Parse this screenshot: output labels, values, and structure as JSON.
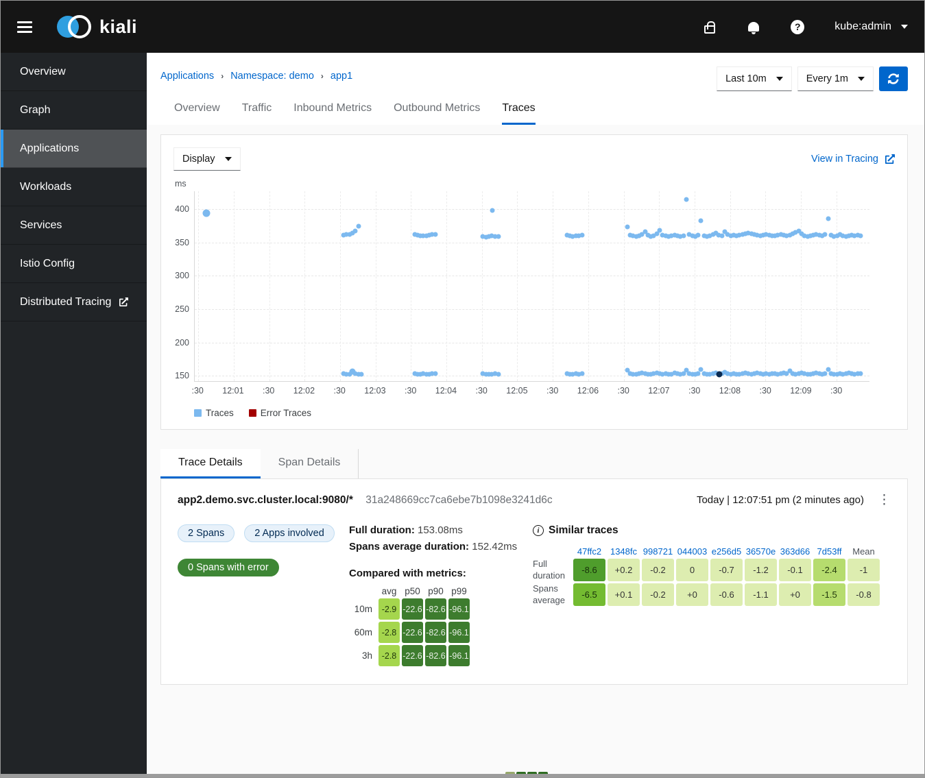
{
  "masthead": {
    "brand": "kiali",
    "user": "kube:admin"
  },
  "sidebar": {
    "active_index": 2,
    "items": [
      {
        "label": "Overview"
      },
      {
        "label": "Graph"
      },
      {
        "label": "Applications"
      },
      {
        "label": "Workloads"
      },
      {
        "label": "Services"
      },
      {
        "label": "Istio Config"
      },
      {
        "label": "Distributed Tracing",
        "external": true
      }
    ]
  },
  "breadcrumb": [
    "Applications",
    "Namespace: demo",
    "app1"
  ],
  "toolbar": {
    "duration": "Last 10m",
    "refresh_interval": "Every 1m"
  },
  "tabs": {
    "active_index": 4,
    "items": [
      "Overview",
      "Traffic",
      "Inbound Metrics",
      "Outbound Metrics",
      "Traces"
    ]
  },
  "chart_card": {
    "display_label": "Display",
    "view_link": "View in Tracing",
    "unit": "ms"
  },
  "chart_data": {
    "type": "scatter",
    "title": "",
    "xlabel": "",
    "ylabel": "ms",
    "grid": true,
    "legend_position": "bottom",
    "x_range": [
      27,
      598
    ],
    "y_range": [
      142,
      427
    ],
    "y_ticks": [
      150,
      200,
      250,
      300,
      350,
      400
    ],
    "x_ticks": [
      {
        "t": 30,
        "label": ":30"
      },
      {
        "t": 60,
        "label": "12:01"
      },
      {
        "t": 90,
        "label": ":30"
      },
      {
        "t": 120,
        "label": "12:02"
      },
      {
        "t": 150,
        "label": ":30"
      },
      {
        "t": 180,
        "label": "12:03"
      },
      {
        "t": 210,
        "label": ":30"
      },
      {
        "t": 240,
        "label": "12:04"
      },
      {
        "t": 270,
        "label": ":30"
      },
      {
        "t": 300,
        "label": "12:05"
      },
      {
        "t": 330,
        "label": ":30"
      },
      {
        "t": 360,
        "label": "12:06"
      },
      {
        "t": 390,
        "label": ":30"
      },
      {
        "t": 420,
        "label": "12:07"
      },
      {
        "t": 450,
        "label": ":30"
      },
      {
        "t": 480,
        "label": "12:08"
      },
      {
        "t": 510,
        "label": ":30"
      },
      {
        "t": 540,
        "label": "12:09"
      },
      {
        "t": 570,
        "label": ":30"
      }
    ],
    "series": [
      {
        "name": "Traces",
        "color": "#7cb9ef",
        "points": [
          [
            37,
            394,
            11
          ],
          [
            153,
            361
          ],
          [
            155.5,
            362
          ],
          [
            158,
            362
          ],
          [
            160.5,
            364
          ],
          [
            163,
            367
          ],
          [
            165.5,
            375
          ],
          [
            153,
            153
          ],
          [
            155.5,
            152
          ],
          [
            158,
            152
          ],
          [
            160.5,
            156,
            9
          ],
          [
            163,
            153
          ],
          [
            165.5,
            152
          ],
          [
            168,
            152
          ],
          [
            213,
            362
          ],
          [
            215.5,
            361
          ],
          [
            218,
            360
          ],
          [
            220.5,
            360
          ],
          [
            223,
            360
          ],
          [
            225.5,
            361
          ],
          [
            228,
            362
          ],
          [
            230.5,
            362
          ],
          [
            213,
            153
          ],
          [
            215.5,
            152
          ],
          [
            218,
            152
          ],
          [
            220.5,
            153
          ],
          [
            223,
            152
          ],
          [
            225.5,
            152
          ],
          [
            228,
            153
          ],
          [
            230.5,
            153
          ],
          [
            271,
            359
          ],
          [
            273.5,
            358
          ],
          [
            276,
            359
          ],
          [
            278.5,
            360
          ],
          [
            281,
            359
          ],
          [
            284,
            359
          ],
          [
            279,
            398
          ],
          [
            271,
            153
          ],
          [
            273.5,
            152
          ],
          [
            276,
            152
          ],
          [
            278.5,
            152
          ],
          [
            281,
            153
          ],
          [
            284,
            152
          ],
          [
            342,
            361
          ],
          [
            344.5,
            360
          ],
          [
            347,
            359
          ],
          [
            349.5,
            360
          ],
          [
            352,
            360
          ],
          [
            355,
            361
          ],
          [
            342,
            153
          ],
          [
            344.5,
            152
          ],
          [
            347,
            152
          ],
          [
            349.5,
            153
          ],
          [
            352,
            152
          ],
          [
            355,
            153
          ],
          [
            393,
            374
          ],
          [
            395.5,
            361
          ],
          [
            398,
            360
          ],
          [
            400.5,
            359
          ],
          [
            403,
            360
          ],
          [
            405.5,
            362
          ],
          [
            408,
            366
          ],
          [
            410.5,
            361
          ],
          [
            413,
            359
          ],
          [
            415.5,
            360
          ],
          [
            418,
            363
          ],
          [
            420.5,
            368
          ],
          [
            423,
            361
          ],
          [
            425.5,
            360
          ],
          [
            428,
            359
          ],
          [
            430.5,
            360
          ],
          [
            433,
            361
          ],
          [
            435.5,
            360
          ],
          [
            438,
            359
          ],
          [
            440.5,
            360
          ],
          [
            443,
            415
          ],
          [
            445.5,
            362
          ],
          [
            448,
            360
          ],
          [
            450.5,
            359
          ],
          [
            453,
            361
          ],
          [
            455.5,
            383
          ],
          [
            458,
            360
          ],
          [
            460.5,
            359
          ],
          [
            463,
            360
          ],
          [
            465.5,
            362
          ],
          [
            468,
            364
          ],
          [
            470.5,
            361
          ],
          [
            473,
            360
          ],
          [
            475.5,
            366
          ],
          [
            478,
            362
          ],
          [
            480.5,
            360
          ],
          [
            483,
            361
          ],
          [
            485.5,
            360
          ],
          [
            488,
            361
          ],
          [
            490.5,
            362
          ],
          [
            493,
            363
          ],
          [
            495.5,
            364
          ],
          [
            498,
            363
          ],
          [
            500.5,
            362
          ],
          [
            503,
            361
          ],
          [
            505.5,
            360
          ],
          [
            508,
            361
          ],
          [
            510.5,
            362
          ],
          [
            513,
            361
          ],
          [
            515.5,
            360
          ],
          [
            518,
            360
          ],
          [
            520.5,
            361
          ],
          [
            523,
            362
          ],
          [
            525.5,
            361
          ],
          [
            528,
            360
          ],
          [
            530.5,
            361
          ],
          [
            533,
            363
          ],
          [
            535.5,
            365
          ],
          [
            538,
            367
          ],
          [
            540.5,
            363
          ],
          [
            543,
            360
          ],
          [
            545.5,
            359
          ],
          [
            548,
            360
          ],
          [
            550.5,
            361
          ],
          [
            553,
            362
          ],
          [
            555.5,
            361
          ],
          [
            558,
            360
          ],
          [
            560.5,
            362
          ],
          [
            563,
            386
          ],
          [
            565.5,
            361
          ],
          [
            568,
            359
          ],
          [
            570.5,
            360
          ],
          [
            573,
            362
          ],
          [
            575.5,
            360
          ],
          [
            578,
            359
          ],
          [
            580.5,
            360
          ],
          [
            583,
            361
          ],
          [
            585.5,
            360
          ],
          [
            588,
            361
          ],
          [
            590.5,
            360
          ],
          [
            393,
            158
          ],
          [
            395.5,
            153
          ],
          [
            398,
            152
          ],
          [
            400.5,
            152
          ],
          [
            403,
            153
          ],
          [
            405.5,
            154
          ],
          [
            408,
            153
          ],
          [
            410.5,
            152
          ],
          [
            413,
            152
          ],
          [
            415.5,
            153
          ],
          [
            418,
            154
          ],
          [
            420.5,
            153
          ],
          [
            423,
            152
          ],
          [
            425.5,
            153
          ],
          [
            428,
            152
          ],
          [
            430.5,
            152
          ],
          [
            433,
            154
          ],
          [
            435.5,
            153
          ],
          [
            438,
            152
          ],
          [
            440.5,
            153
          ],
          [
            443,
            158
          ],
          [
            445.5,
            153
          ],
          [
            448,
            152
          ],
          [
            450.5,
            152
          ],
          [
            453,
            153
          ],
          [
            455.5,
            160
          ],
          [
            458,
            153
          ],
          [
            460.5,
            152
          ],
          [
            463,
            152
          ],
          [
            465.5,
            153
          ],
          [
            468,
            154
          ],
          [
            473,
            153
          ],
          [
            475.5,
            155
          ],
          [
            478,
            153
          ],
          [
            480.5,
            152
          ],
          [
            483,
            153
          ],
          [
            485.5,
            152
          ],
          [
            488,
            152
          ],
          [
            490.5,
            153
          ],
          [
            493,
            154
          ],
          [
            495.5,
            153
          ],
          [
            498,
            152
          ],
          [
            500.5,
            153
          ],
          [
            503,
            154
          ],
          [
            505.5,
            153
          ],
          [
            508,
            152
          ],
          [
            510.5,
            153
          ],
          [
            513,
            152
          ],
          [
            515.5,
            153
          ],
          [
            518,
            153
          ],
          [
            520.5,
            152
          ],
          [
            523,
            153
          ],
          [
            525.5,
            154
          ],
          [
            528,
            153
          ],
          [
            530.5,
            157
          ],
          [
            533,
            153
          ],
          [
            535.5,
            152
          ],
          [
            538,
            153
          ],
          [
            540.5,
            154
          ],
          [
            543,
            153
          ],
          [
            545.5,
            152
          ],
          [
            548,
            152
          ],
          [
            550.5,
            153
          ],
          [
            553,
            154
          ],
          [
            555.5,
            153
          ],
          [
            558,
            152
          ],
          [
            560.5,
            153
          ],
          [
            563,
            160
          ],
          [
            565.5,
            153
          ],
          [
            568,
            152
          ],
          [
            570.5,
            152
          ],
          [
            573,
            153
          ],
          [
            575.5,
            152
          ],
          [
            578,
            153
          ],
          [
            580.5,
            154
          ],
          [
            583,
            153
          ],
          [
            585.5,
            152
          ],
          [
            588,
            153
          ],
          [
            590.5,
            153
          ]
        ]
      },
      {
        "name": "Error Traces",
        "color": "#a30000",
        "points": []
      }
    ],
    "selected_point": {
      "t": 471,
      "v": 152,
      "d": 9,
      "color": "#0a2b52"
    }
  },
  "details": {
    "tabs": {
      "active_index": 0,
      "items": [
        "Trace Details",
        "Span Details"
      ]
    },
    "service": "app2.demo.svc.cluster.local:9080/*",
    "trace_id": "31a248669cc7ca6ebe7b1098e3241d6c",
    "timestamp": "Today | 12:07:51 pm (2 minutes ago)",
    "badges": [
      "2 Spans",
      "2 Apps involved"
    ],
    "error_badge": "0 Spans with error",
    "full_duration_label": "Full duration:",
    "full_duration_value": "153.08ms",
    "spans_avg_label": "Spans average duration:",
    "spans_avg_value": "152.42ms",
    "compared_heading": "Compared with metrics:",
    "metrics_table": {
      "columns": [
        "avg",
        "p50",
        "p90",
        "p99"
      ],
      "rows": [
        {
          "label": "10m",
          "values": [
            "-2.9",
            "-22.6",
            "-82.6",
            "-96.1"
          ]
        },
        {
          "label": "60m",
          "values": [
            "-2.8",
            "-22.6",
            "-82.6",
            "-96.1"
          ]
        },
        {
          "label": "3h",
          "values": [
            "-2.8",
            "-22.6",
            "-82.6",
            "-96.1"
          ]
        }
      ]
    },
    "similar": {
      "heading": "Similar traces",
      "columns": [
        "47ffc2",
        "1348fc",
        "998721",
        "044003",
        "e256d5",
        "36570e",
        "363d66",
        "7d53ff",
        "Mean"
      ],
      "rows": [
        {
          "label": "Full duration",
          "values": [
            "-8.6",
            "+0.2",
            "-0.2",
            "0",
            "-0.7",
            "-1.2",
            "-0.1",
            "-2.4",
            "-1"
          ]
        },
        {
          "label": "Spans average",
          "values": [
            "-6.5",
            "+0.1",
            "-0.2",
            "+0",
            "-0.6",
            "-1.1",
            "+0",
            "-1.5",
            "-0.8"
          ]
        }
      ]
    }
  }
}
